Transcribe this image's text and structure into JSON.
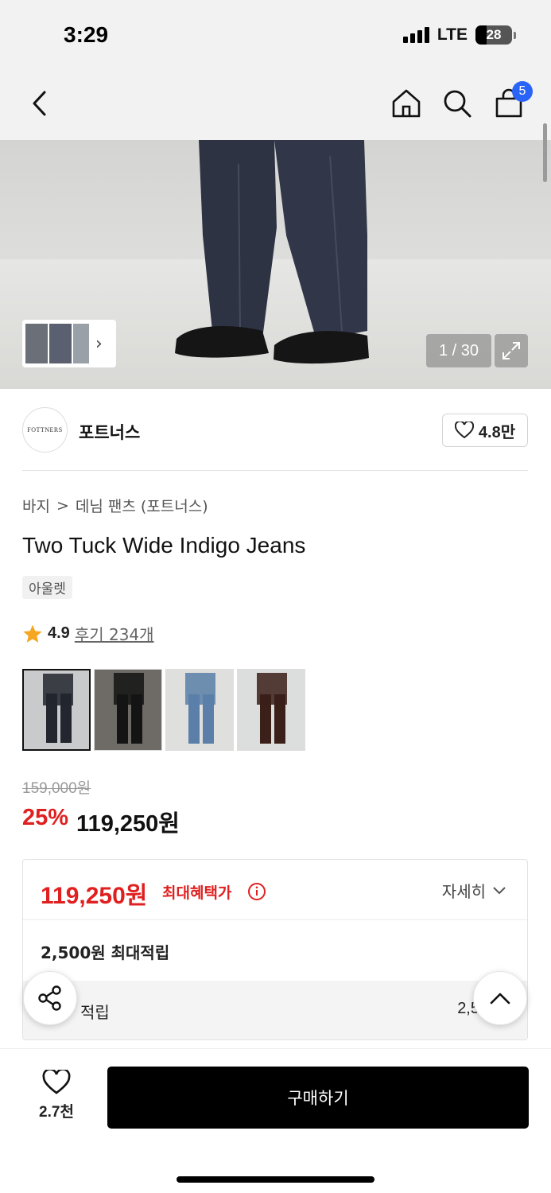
{
  "status_bar": {
    "time": "3:29",
    "network": "LTE",
    "battery": "28"
  },
  "nav": {
    "cart_count": "5"
  },
  "hero": {
    "counter": "1 / 30"
  },
  "brand": {
    "logo_text": "FOTTNERS",
    "name": "포트너스",
    "likes": "4.8만"
  },
  "breadcrumb": {
    "category": "바지",
    "separator": ">",
    "subcategory": "데님 팬츠 (포트너스)"
  },
  "product": {
    "title": "Two Tuck Wide Indigo Jeans",
    "tag": "아울렛",
    "rating": "4.9",
    "reviews": "후기 234개",
    "original_price": "159,000원",
    "discount": "25%",
    "sale_price": "119,250원"
  },
  "colors": {
    "accent_red": "#e02020",
    "badge_blue": "#2a64f6",
    "star": "#f5a623",
    "swatches": [
      {
        "name": "indigo",
        "bg": "#c9cacc",
        "leg": "#23262e",
        "selected": true
      },
      {
        "name": "black-leather",
        "bg": "#6e6a66",
        "leg": "#141414",
        "selected": false
      },
      {
        "name": "light-blue",
        "bg": "#dfe0dd",
        "leg": "#5b7fa8",
        "selected": false
      },
      {
        "name": "brown",
        "bg": "#dcdedd",
        "leg": "#3b2019",
        "selected": false
      }
    ]
  },
  "benefit": {
    "price": "119,250원",
    "label": "최대혜택가",
    "detail": "자세히",
    "points_title": "2,500원 최대적립",
    "points_label": "적립",
    "points_value": "2,5"
  },
  "bottom": {
    "wish_count": "2.7천",
    "buy_label": "구매하기"
  }
}
